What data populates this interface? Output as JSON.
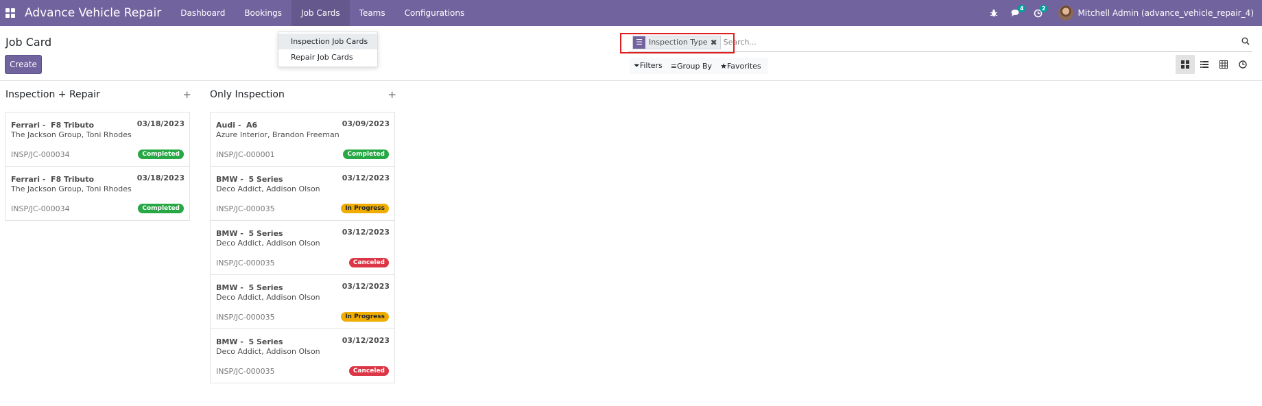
{
  "navbar": {
    "app_title": "Advance Vehicle Repair",
    "menu": [
      "Dashboard",
      "Bookings",
      "Job Cards",
      "Teams",
      "Configurations"
    ],
    "active_menu": "Job Cards",
    "messages_count": "4",
    "activities_count": "2",
    "user_name": "Mitchell Admin (advance_vehicle_repair_4)",
    "brand_color": "#71639e"
  },
  "dropdown": {
    "items": [
      "Inspection Job Cards",
      "Repair Job Cards"
    ]
  },
  "control_panel": {
    "title": "Job Card",
    "create_label": "Create",
    "facet_label": "Inspection Type",
    "search_placeholder": "Search...",
    "filters_label": "Filters",
    "group_by_label": "Group By",
    "favorites_label": "Favorites"
  },
  "columns": [
    {
      "title": "Inspection + Repair",
      "cards": [
        {
          "title": "Ferrari -  F8 Tributo",
          "date": "03/18/2023",
          "customer": "The Jackson Group, Toni Rhodes",
          "ref": "INSP/JC-000034",
          "status": "Completed"
        },
        {
          "title": "Ferrari -  F8 Tributo",
          "date": "03/18/2023",
          "customer": "The Jackson Group, Toni Rhodes",
          "ref": "INSP/JC-000034",
          "status": "Completed"
        }
      ]
    },
    {
      "title": "Only Inspection",
      "cards": [
        {
          "title": "Audi -  A6",
          "date": "03/09/2023",
          "customer": "Azure Interior, Brandon Freeman",
          "ref": "INSP/JC-000001",
          "status": "Completed"
        },
        {
          "title": "BMW -  5 Series",
          "date": "03/12/2023",
          "customer": "Deco Addict, Addison Olson",
          "ref": "INSP/JC-000035",
          "status": "In Progress"
        },
        {
          "title": "BMW -  5 Series",
          "date": "03/12/2023",
          "customer": "Deco Addict, Addison Olson",
          "ref": "INSP/JC-000035",
          "status": "Canceled"
        },
        {
          "title": "BMW -  5 Series",
          "date": "03/12/2023",
          "customer": "Deco Addict, Addison Olson",
          "ref": "INSP/JC-000035",
          "status": "In Progress"
        },
        {
          "title": "BMW -  5 Series",
          "date": "03/12/2023",
          "customer": "Deco Addict, Addison Olson",
          "ref": "INSP/JC-000035",
          "status": "Canceled"
        }
      ]
    }
  ]
}
